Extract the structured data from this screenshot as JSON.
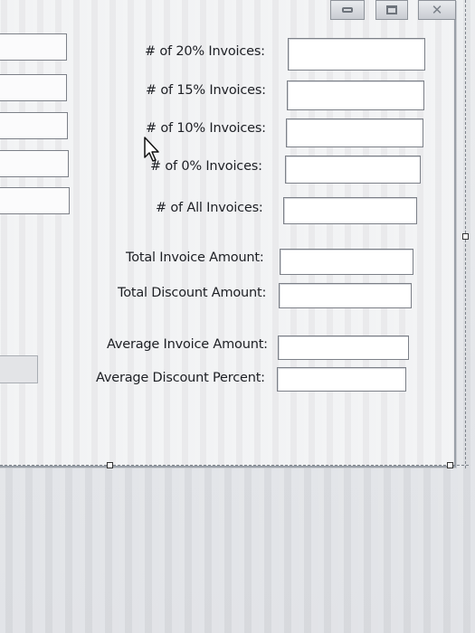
{
  "window": {
    "buttons": [
      {
        "name": "minimize",
        "icon": "minimize-icon"
      },
      {
        "name": "maximize",
        "icon": "maximize-icon"
      },
      {
        "name": "close",
        "icon": "close-icon",
        "glyph": "✕"
      }
    ]
  },
  "form": {
    "fields": [
      {
        "label": "# of 20% Invoices:",
        "value": ""
      },
      {
        "label": "# of 15% Invoices:",
        "value": ""
      },
      {
        "label": "# of 10% Invoices:",
        "value": ""
      },
      {
        "label": "# of 0% Invoices:",
        "value": ""
      },
      {
        "label": "# of All Invoices:",
        "value": ""
      },
      {
        "label": "Total Invoice Amount:",
        "value": ""
      },
      {
        "label": "Total Discount Amount:",
        "value": ""
      },
      {
        "label": "Average Invoice Amount:",
        "value": ""
      },
      {
        "label": "Average Discount Percent:",
        "value": ""
      }
    ]
  }
}
